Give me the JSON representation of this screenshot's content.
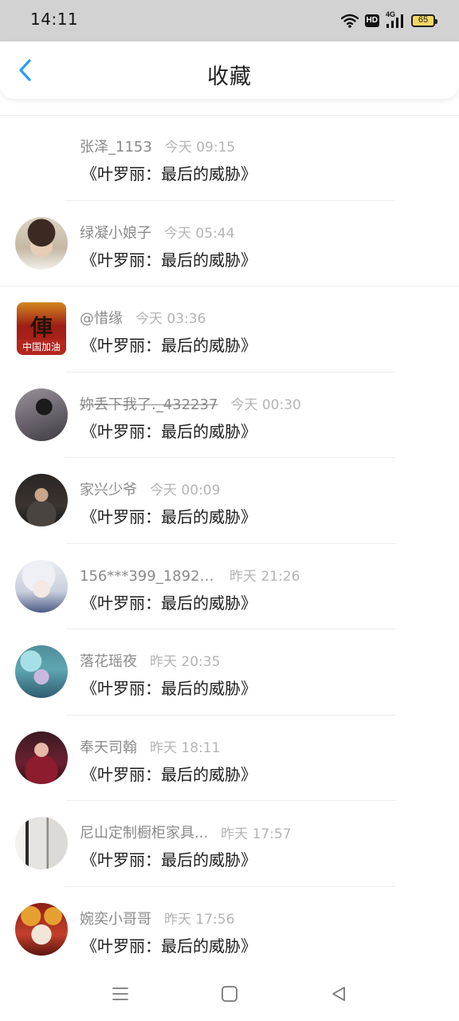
{
  "status_bar": {
    "time": "14:11",
    "network": "4G",
    "hd": "HD",
    "battery": "65"
  },
  "header": {
    "title": "收藏",
    "back_icon": "chevron-left-icon",
    "accent_color": "#2a9df4"
  },
  "items": [
    {
      "name": "张泽_1153",
      "time": "今天 09:15",
      "content": "《叶罗丽：最后的威胁》",
      "avatar": "none"
    },
    {
      "name": "绿凝小娘子",
      "time": "今天 05:44",
      "content": "《叶罗丽：最后的威胁》",
      "avatar": "#c9b9a3"
    },
    {
      "name": "@惜缘",
      "time": "今天 03:36",
      "content": "《叶罗丽：最后的威胁》",
      "avatar": "#b3261e",
      "avatar_text": "中国加油",
      "avatar_glyph": "俥"
    },
    {
      "name": "妳丢下我了._432237",
      "time": "今天 00:30",
      "content": "《叶罗丽：最后的威胁》",
      "avatar": "#6d6670"
    },
    {
      "name": "家兴少爷",
      "time": "今天 00:09",
      "content": "《叶罗丽：最后的威胁》",
      "avatar": "#3b3430"
    },
    {
      "name": "156***399_18922...",
      "time": "昨天 21:26",
      "content": "《叶罗丽：最后的威胁》",
      "avatar": "#d8dce6"
    },
    {
      "name": "落花瑶夜",
      "time": "昨天 20:35",
      "content": "《叶罗丽：最后的威胁》",
      "avatar": "#5fa6b2"
    },
    {
      "name": "奉天司翰",
      "time": "昨天 18:11",
      "content": "《叶罗丽：最后的威胁》",
      "avatar": "#6b2131"
    },
    {
      "name": "尼山定制橱柜家具...",
      "time": "昨天 17:57",
      "content": "《叶罗丽：最后的威胁》",
      "avatar": "#bdbab6"
    },
    {
      "name": "婉奕小哥哥",
      "time": "昨天 17:56",
      "content": "《叶罗丽：最后的威胁》",
      "avatar": "#c2402b"
    }
  ],
  "bottom_nav": {
    "menu_icon": "menu-icon",
    "home_icon": "home-square-icon",
    "back_icon": "back-triangle-icon"
  }
}
